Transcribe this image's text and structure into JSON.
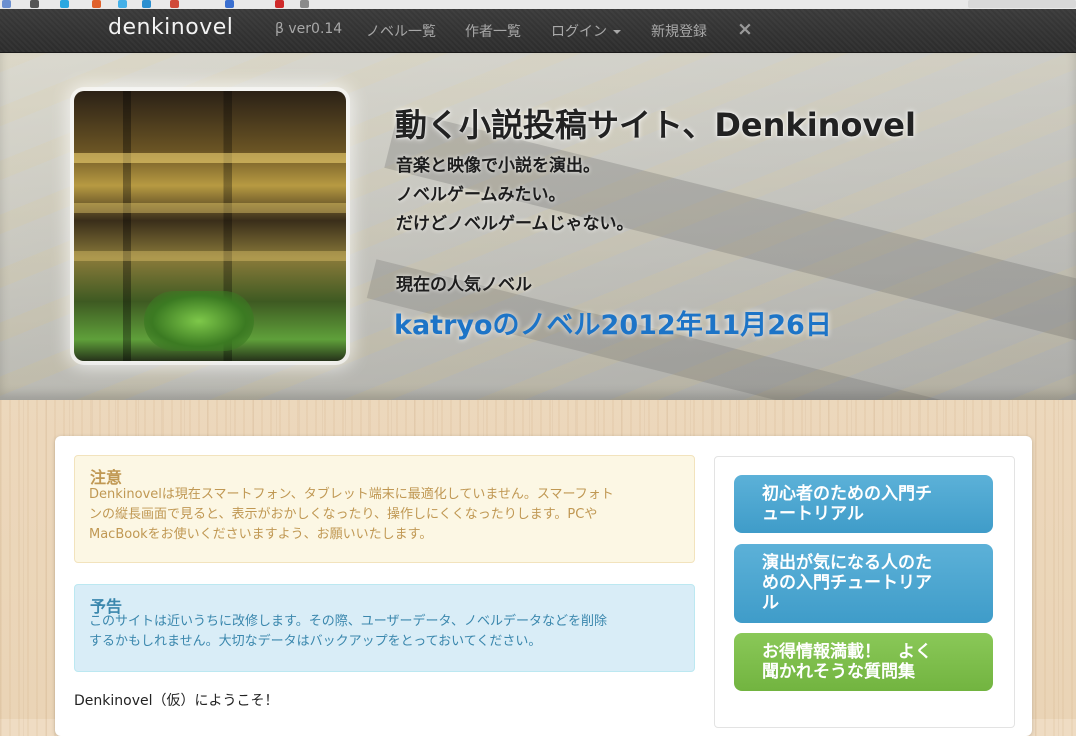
{
  "navbar": {
    "brand": "denkinovel",
    "version": "β ver0.14",
    "items": [
      {
        "label": "ノベル一覧"
      },
      {
        "label": "作者一覧"
      },
      {
        "label": "ログイン"
      },
      {
        "label": "新規登録"
      }
    ],
    "close_symbol": "×"
  },
  "hero": {
    "title": "動く小説投稿サイト、Denkinovel",
    "lines": [
      "音楽と映像で小説を演出。",
      "ノベルゲームみたい。",
      "だけどノベルゲームじゃない。"
    ],
    "popular_label": "現在の人気ノベル",
    "popular_novel": "katryoのノベル2012年11月26日"
  },
  "notices": {
    "warning": {
      "title": "注意",
      "lines": [
        "Denkinovelは現在スマートフォン、タブレット端末に最適化していません。スマーフォト",
        "ンの縦長画面で見ると、表示がおかしくなったり、操作しにくくなったりします。PCや",
        "MacBookをお使いくださいますよう、お願いいたします。"
      ]
    },
    "info": {
      "title": "予告",
      "lines": [
        "このサイトは近いうちに改修します。その際、ユーザーデータ、ノベルデータなどを削除",
        "するかもしれません。大切なデータはバックアップをとっておいてください。"
      ]
    }
  },
  "welcome_text": "Denkinovel（仮）にようこそ！",
  "sidebar": {
    "buttons": [
      {
        "lines": [
          "初心者のための入門チ",
          "ュートリアル"
        ],
        "color": "#4aa3d0"
      },
      {
        "lines": [
          "演出が気になる人のた",
          "めの入門チュートリア",
          "ル"
        ],
        "color": "#4aa3d0"
      },
      {
        "lines": [
          "お得情報満載！　よく",
          "聞かれそうな質問集"
        ],
        "color": "#7fbf4d"
      }
    ]
  },
  "colors": {
    "navbar_bg": "#2f2f2f",
    "accent_link": "#1d74c7",
    "warning_text": "#c09853",
    "info_text": "#3a87ad"
  },
  "icons": [
    "close-icon",
    "caret-down-icon"
  ]
}
